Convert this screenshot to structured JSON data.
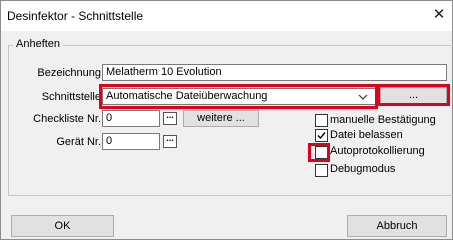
{
  "window": {
    "title": "Desinfektor - Schnittstelle",
    "close_glyph": "✕"
  },
  "group": {
    "legend": "Anheften"
  },
  "fields": {
    "bezeichnung": {
      "label": "Bezeichnung",
      "value": "Melatherm 10 Evolution"
    },
    "schnittstelle": {
      "label": "Schnittstelle",
      "value": "Automatische Dateiüberwachung",
      "browse_label": "..."
    },
    "checkliste": {
      "label": "Checkliste Nr.",
      "value": "0",
      "more_label": "weitere ..."
    },
    "geraet": {
      "label": "Gerät Nr.",
      "value": "0"
    }
  },
  "options": [
    {
      "label": "manuelle Bestätigung",
      "checked": false
    },
    {
      "label": "Datei belassen",
      "checked": true
    },
    {
      "label": "Autoprotokollierung",
      "checked": false
    },
    {
      "label": "Debugmodus",
      "checked": false
    }
  ],
  "buttons": {
    "ok": "OK",
    "cancel": "Abbruch"
  },
  "colors": {
    "highlight": "#e3001b",
    "dialog_bg": "#f0f0f0"
  },
  "icons": {
    "close": "close-icon",
    "dropdown": "chevron-down-icon",
    "ellipsis": "ellipsis-icon",
    "check": "checkmark-icon"
  }
}
